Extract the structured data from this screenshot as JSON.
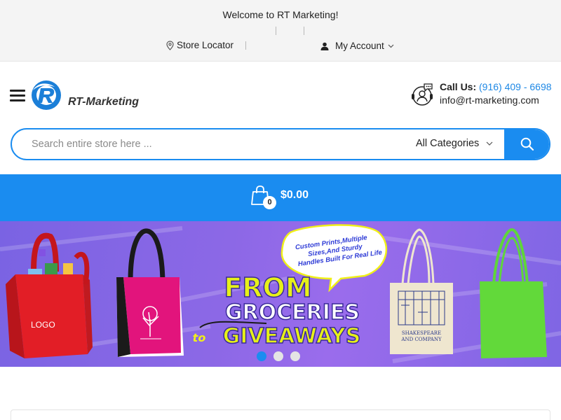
{
  "topbar": {
    "welcome": "Welcome to RT Marketing!",
    "store_locator": "Store Locator",
    "my_account": "My Account"
  },
  "header": {
    "logo_text": "RT-Marketing",
    "call_label": "Call Us:",
    "phone": "(916) 409 - 6698",
    "email": "info@rt-marketing.com"
  },
  "search": {
    "placeholder": "Search entire store here ...",
    "value": "",
    "category": "All Categories"
  },
  "cart": {
    "count": "0",
    "total": "$0.00"
  },
  "banner": {
    "bubble_text": "Custom Prints,Multiple Sizes,And Sturdy Handles Built For Real Life",
    "headline_1": "FROM",
    "headline_2": "GROCERIES",
    "headline_to": "to",
    "headline_3": "GIVEAWAYS",
    "bag_logo": "LOGO",
    "tote_print_1": "SHAKESPEARE",
    "tote_print_2": "AND COMPANY",
    "active_slide": 1,
    "slide_count": 3
  },
  "colors": {
    "brand_blue": "#1a8cf0",
    "banner_purple": "#8c68e6",
    "headline_yellow": "#e6f019"
  }
}
